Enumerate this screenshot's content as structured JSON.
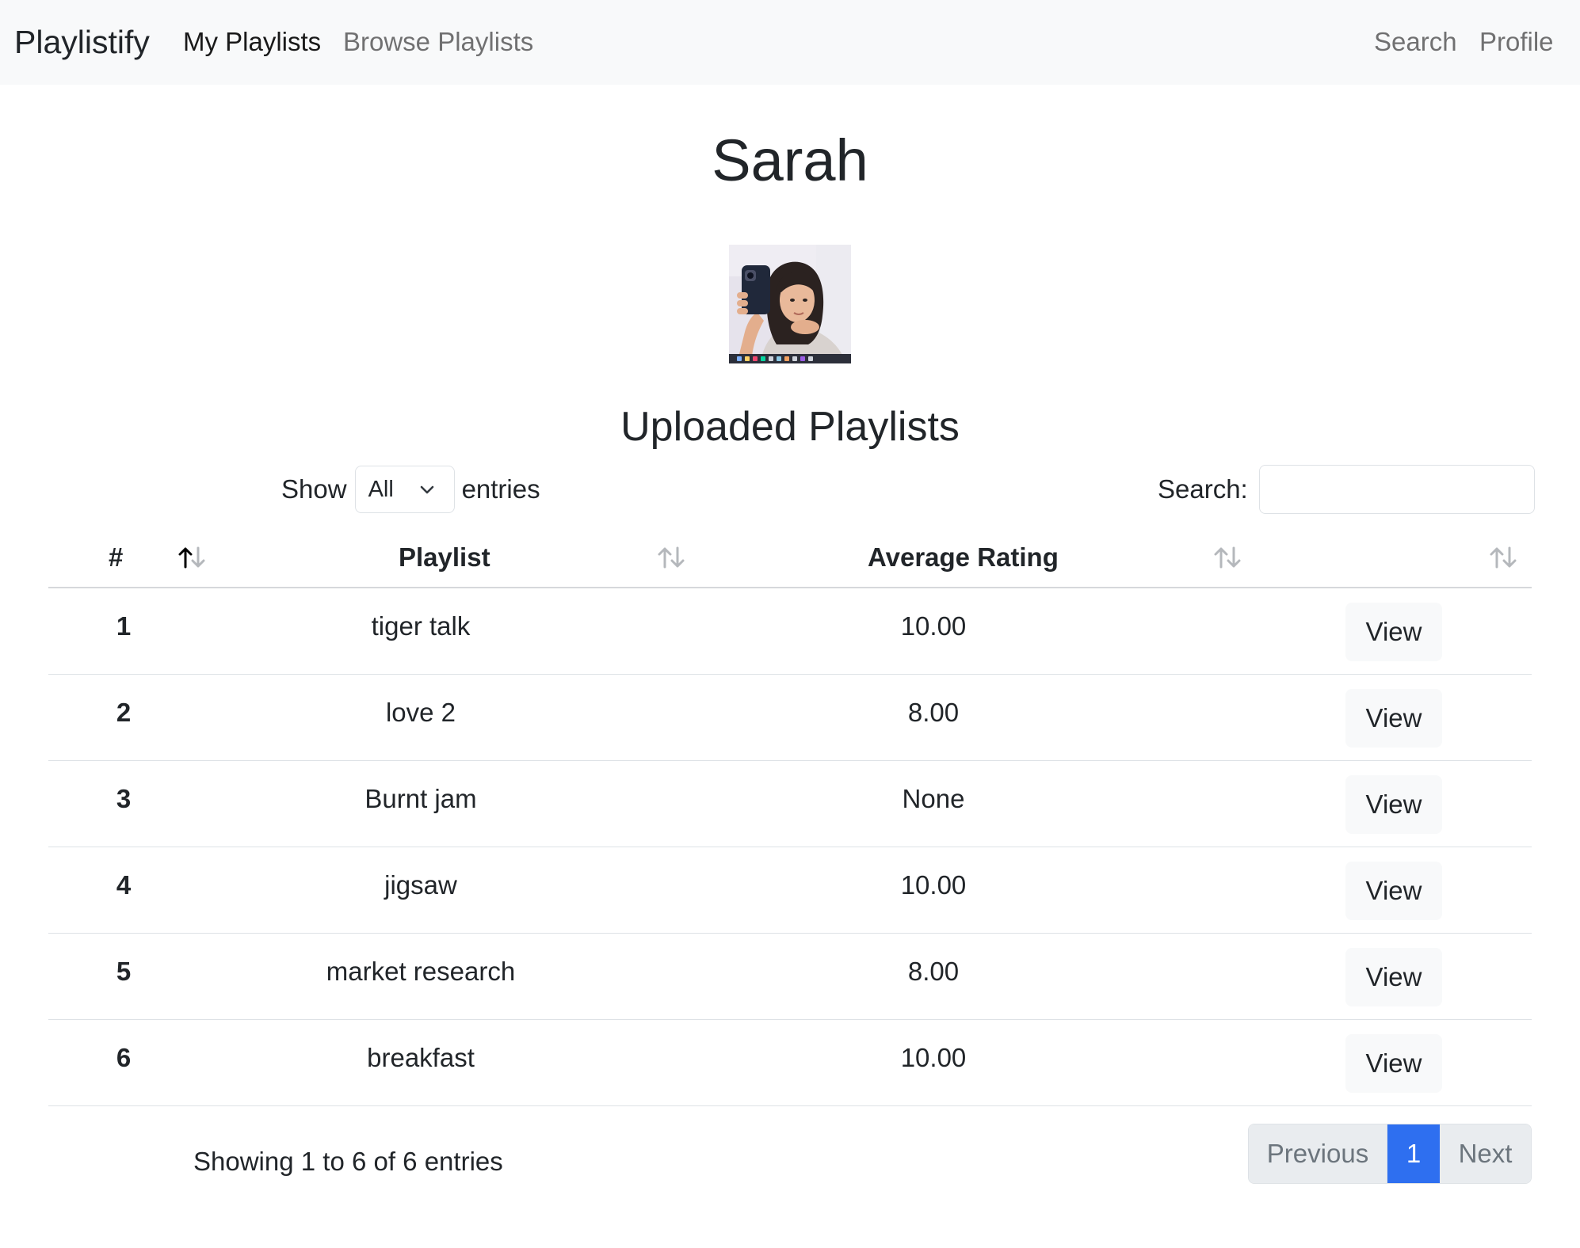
{
  "navbar": {
    "brand": "Playlistify",
    "links": {
      "my_playlists": "My Playlists",
      "browse_playlists": "Browse Playlists",
      "search": "Search",
      "profile": "Profile"
    }
  },
  "profile": {
    "name": "Sarah"
  },
  "section": {
    "title": "Uploaded Playlists"
  },
  "controls": {
    "show_label": "Show",
    "length_value": "All",
    "entries_label": "entries",
    "search_label": "Search:",
    "search_value": ""
  },
  "table": {
    "headers": {
      "num": "#",
      "playlist": "Playlist",
      "rating": "Average Rating",
      "action": ""
    },
    "rows": [
      {
        "num": "1",
        "playlist": "tiger talk",
        "rating": "10.00",
        "action": "View"
      },
      {
        "num": "2",
        "playlist": "love 2",
        "rating": "8.00",
        "action": "View"
      },
      {
        "num": "3",
        "playlist": "Burnt jam",
        "rating": "None",
        "action": "View"
      },
      {
        "num": "4",
        "playlist": "jigsaw",
        "rating": "10.00",
        "action": "View"
      },
      {
        "num": "5",
        "playlist": "market research",
        "rating": "8.00",
        "action": "View"
      },
      {
        "num": "6",
        "playlist": "breakfast",
        "rating": "10.00",
        "action": "View"
      }
    ]
  },
  "footer": {
    "info": "Showing 1 to 6 of 6 entries",
    "pagination": {
      "previous": "Previous",
      "current": "1",
      "next": "Next"
    }
  },
  "colors": {
    "navbar_bg": "#f8f9fa",
    "accent": "#2e6ff0",
    "text": "#212529",
    "muted": "#6c757d"
  },
  "icons": {
    "sort_active": "sort-ascending-icon",
    "sort_inactive": "sort-both-icon",
    "select_caret": "chevron-down-icon",
    "avatar": "profile-photo"
  }
}
